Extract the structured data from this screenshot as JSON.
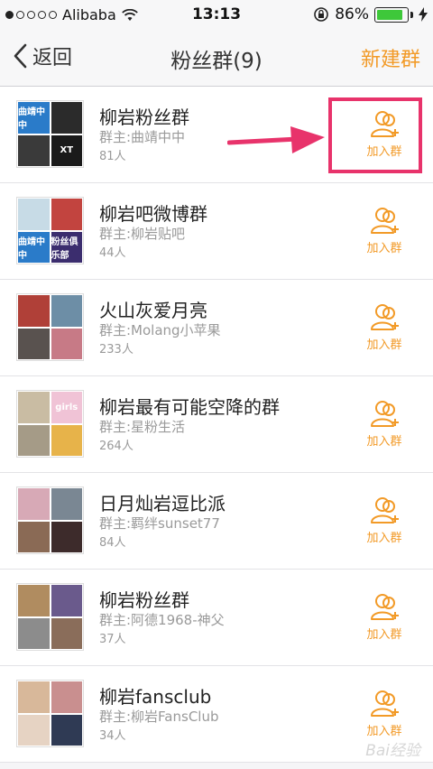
{
  "status_bar": {
    "carrier": "Alibaba",
    "time": "13:13",
    "battery_percent": "86%",
    "battery_level": 0.86,
    "signal_dots_filled": 1
  },
  "nav": {
    "back_label": "返回",
    "title": "粉丝群(9)",
    "new_group_label": "新建群"
  },
  "join_label": "加入群",
  "groups": [
    {
      "name": "柳岩粉丝群",
      "owner": "群主:曲靖中中",
      "members": "81人",
      "tiles": [
        "曲靖中中",
        "",
        "",
        "XT"
      ]
    },
    {
      "name": "柳岩吧微博群",
      "owner": "群主:柳岩贴吧",
      "members": "44人",
      "tiles": [
        "",
        "",
        "曲靖中中",
        "粉丝俱乐部"
      ]
    },
    {
      "name": "火山灰爱月亮",
      "owner": "群主:Molang小苹果",
      "members": "233人",
      "tiles": [
        "",
        "",
        "",
        ""
      ]
    },
    {
      "name": "柳岩最有可能空降的群",
      "owner": "群主:星粉生活",
      "members": "264人",
      "tiles": [
        "",
        "girls",
        "",
        ""
      ]
    },
    {
      "name": "日月灿岩逗比派",
      "owner": "群主:羁绊sunset77",
      "members": "84人",
      "tiles": [
        "",
        "",
        "",
        ""
      ]
    },
    {
      "name": "柳岩粉丝群",
      "owner": "群主:阿德1968-神父",
      "members": "37人",
      "tiles": [
        "",
        "",
        "",
        ""
      ]
    },
    {
      "name": "柳岩fansclub",
      "owner": "群主:柳岩FansClub",
      "members": "34人",
      "tiles": [
        "",
        "",
        "",
        ""
      ]
    }
  ],
  "colors": {
    "accent": "#f29a27",
    "highlight": "#e8336b"
  },
  "watermark": "Bai经验"
}
